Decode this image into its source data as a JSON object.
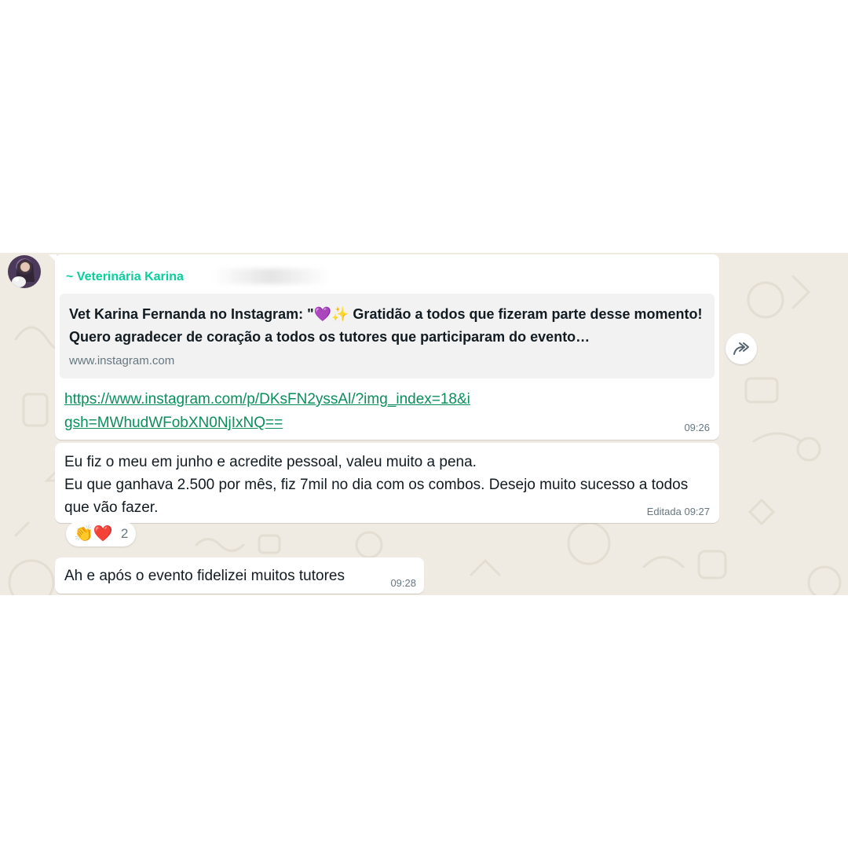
{
  "message_1": {
    "sender_name": "~ Veterinária Karina",
    "preview_title": "Vet Karina Fernanda no Instagram: \"💜✨ Gratidão a todos que fizeram parte desse momento! Quero agradecer de coração a todos os tutores que participaram do evento…",
    "preview_site": "www.instagram.com",
    "link_text": "https://www.instagram.com/p/DKsFN2yssAl/?img_index=18&igsh=MWhudWFobXN0NjIxNQ==",
    "time": "09:26"
  },
  "message_2": {
    "text": "Eu fiz o meu em junho e acredite pessoal, valeu muito a pena.\nEu que ganhava 2.500 por mês, fiz 7mil no dia com os combos. Desejo muito sucesso a todos que vão fazer.",
    "time": "Editada 09:27",
    "reactions": {
      "emojis": "👏❤️",
      "count": "2"
    }
  },
  "message_3": {
    "text": "Ah e após o evento fidelizei muitos tutores",
    "time": "09:28"
  },
  "icons": {
    "forward": "forward-icon",
    "avatar": "avatar"
  },
  "colors": {
    "chat_background": "#efeae2",
    "sender_name": "#06cf9c",
    "link": "#0a8f5c",
    "meta": "#667781"
  }
}
